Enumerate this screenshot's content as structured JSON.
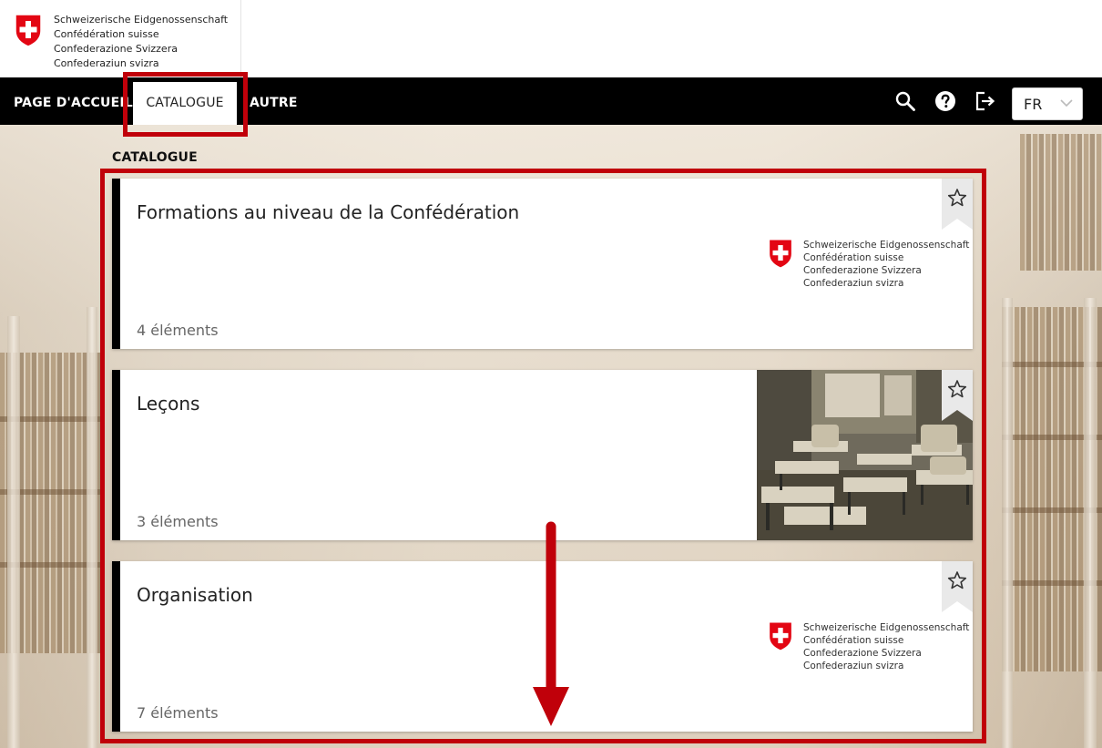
{
  "header": {
    "logo_lines": [
      "Schweizerische Eidgenossenschaft",
      "Confédération suisse",
      "Confederazione Svizzera",
      "Confederaziun svizra"
    ]
  },
  "nav": {
    "items": [
      {
        "label": "PAGE D'ACCUEIL"
      },
      {
        "label": "CATALOGUE"
      },
      {
        "label": "AUTRE"
      }
    ],
    "language": "FR",
    "icons": [
      "search-icon",
      "help-icon",
      "logout-icon",
      "chevron-down-icon"
    ]
  },
  "page": {
    "title": "CATALOGUE"
  },
  "cards": [
    {
      "title": "Formations au niveau de la Confédération",
      "count": "4 éléments",
      "media": "confederation-logo"
    },
    {
      "title": "Leçons",
      "count": "3 éléments",
      "media": "classroom-photo"
    },
    {
      "title": "Organisation",
      "count": "7 éléments",
      "media": "confederation-logo"
    }
  ],
  "colors": {
    "nav_bg": "#000000",
    "accent_red": "#c0000a",
    "swiss_red": "#e30613"
  }
}
